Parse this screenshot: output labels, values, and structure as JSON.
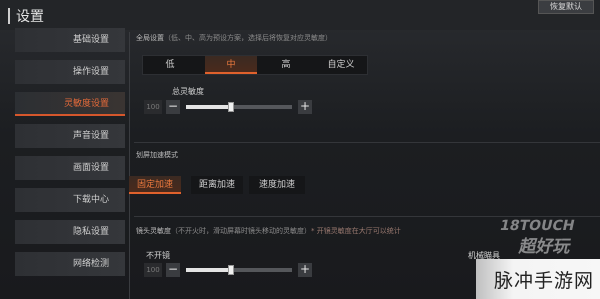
{
  "header": {
    "title": "设置",
    "reset_label": "恢复默认"
  },
  "sidebar": {
    "items": [
      {
        "label": "基础设置",
        "active": false
      },
      {
        "label": "操作设置",
        "active": false
      },
      {
        "label": "灵敏度设置",
        "active": true
      },
      {
        "label": "声音设置",
        "active": false
      },
      {
        "label": "画面设置",
        "active": false
      },
      {
        "label": "下载中心",
        "active": false
      },
      {
        "label": "隐私设置",
        "active": false
      },
      {
        "label": "网络检测",
        "active": false
      }
    ]
  },
  "global": {
    "label": "全局设置",
    "note": "（低、中、高为预设方案，选择后将恢复对应灵敏度）",
    "options": [
      "低",
      "中",
      "高",
      "自定义"
    ],
    "selected": "中"
  },
  "total_sensitivity": {
    "label": "总灵敏度",
    "value": "100",
    "level": 0.42
  },
  "scope_accel": {
    "label": "划屏加速模式",
    "options": [
      "固定加速",
      "距离加速",
      "速度加速"
    ],
    "selected": "固定加速"
  },
  "scope_sensitivity": {
    "label": "镜头灵敏度",
    "note": "（不开火时，滑动屏幕时镜头移动的灵敏度）",
    "note_red": "* 开镜灵敏度在大厅可以统计",
    "row_left": "不开镜",
    "row_right": "机械瞄具",
    "value": "100",
    "level": 0.42
  },
  "watermark": {
    "text": "脉冲手游网",
    "logo_top": "18TOUCH",
    "logo_bottom": "超好玩"
  },
  "colors": {
    "accent": "#e0612c",
    "bg": "#1f2124"
  }
}
